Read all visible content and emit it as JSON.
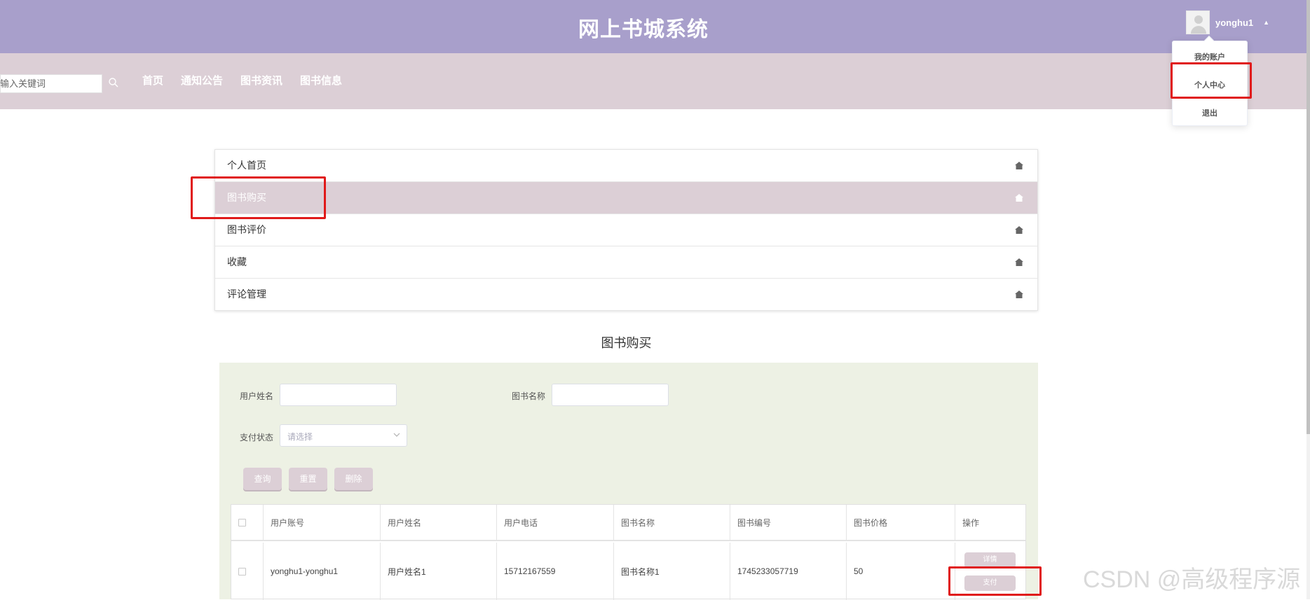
{
  "header": {
    "title": "网上书城系统",
    "username": "yonghu1"
  },
  "nav": {
    "search_placeholder": "请输入关键词",
    "links": [
      "首页",
      "通知公告",
      "图书资讯",
      "图书信息"
    ]
  },
  "user_menu": {
    "items": [
      "我的账户",
      "个人中心",
      "退出"
    ]
  },
  "sidebar_menu": {
    "items": [
      {
        "label": "个人首页",
        "active": false
      },
      {
        "label": "图书购买",
        "active": true
      },
      {
        "label": "图书评价",
        "active": false
      },
      {
        "label": "收藏",
        "active": false
      },
      {
        "label": "评论管理",
        "active": false
      }
    ]
  },
  "page": {
    "section_title": "图书购买"
  },
  "filters": {
    "user_name_label": "用户姓名",
    "book_name_label": "图书名称",
    "pay_status_label": "支付状态",
    "pay_status_placeholder": "请选择",
    "query_button": "查询",
    "reset_button": "重置",
    "delete_button": "删除"
  },
  "table": {
    "columns": [
      "用户账号",
      "用户姓名",
      "用户电话",
      "图书名称",
      "图书编号",
      "图书价格",
      "操作"
    ],
    "rows": [
      {
        "account": "yonghu1-yonghu1",
        "name": "用户姓名1",
        "phone": "15712167559",
        "book_name": "图书名称1",
        "book_no": "1745233057719",
        "price": "50",
        "actions": [
          "详情",
          "支付"
        ]
      }
    ]
  },
  "watermark": "CSDN @高级程序源",
  "colors": {
    "header_bg": "#a89fcb",
    "nav_bg": "#dccfd6",
    "panel_bg": "#edf1e4",
    "highlight_red": "#e01a1a"
  }
}
